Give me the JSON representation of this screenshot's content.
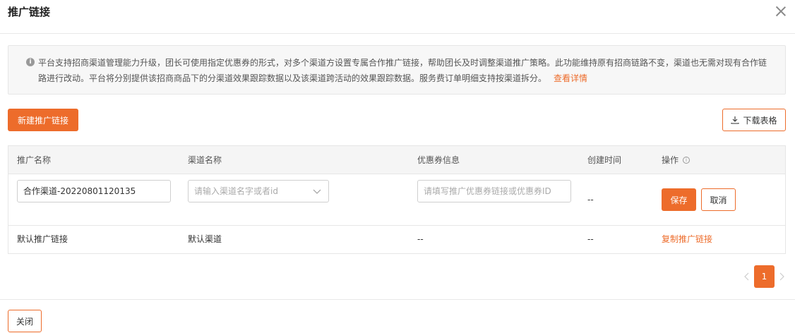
{
  "dialog": {
    "title": "推广链接"
  },
  "notice": {
    "icon": "info-icon",
    "text": "平台支持招商渠道管理能力升级，团长可使用指定优惠券的形式，对多个渠道方设置专属合作推广链接，帮助团长及时调整渠道推广策略。此功能维持原有招商链路不变，渠道也无需对现有合作链路进行改动。平台将分别提供该招商商品下的分渠道效果跟踪数据以及该渠道跨活动的效果跟踪数据。服务费订单明细支持按渠道拆分。",
    "link_label": "查看详情"
  },
  "toolbar": {
    "new_button": "新建推广链接",
    "download_button": "下载表格"
  },
  "table": {
    "headers": [
      "推广名称",
      "渠道名称",
      "优惠券信息",
      "创建时间",
      "操作"
    ],
    "editing_row": {
      "name_value": "合作渠道-20220801120135",
      "channel_placeholder": "请输入渠道名字或者id",
      "coupon_placeholder": "请填写推广优惠券链接或优惠券ID",
      "created_time": "--",
      "save_label": "保存",
      "cancel_label": "取消"
    },
    "rows": [
      {
        "name": "默认推广链接",
        "channel": "默认渠道",
        "coupon": "--",
        "created_time": "--",
        "action": "复制推广链接"
      }
    ]
  },
  "pagination": {
    "current_page": "1"
  },
  "footer": {
    "close_button": "关闭"
  },
  "colors": {
    "accent": "#ed6c2b"
  }
}
